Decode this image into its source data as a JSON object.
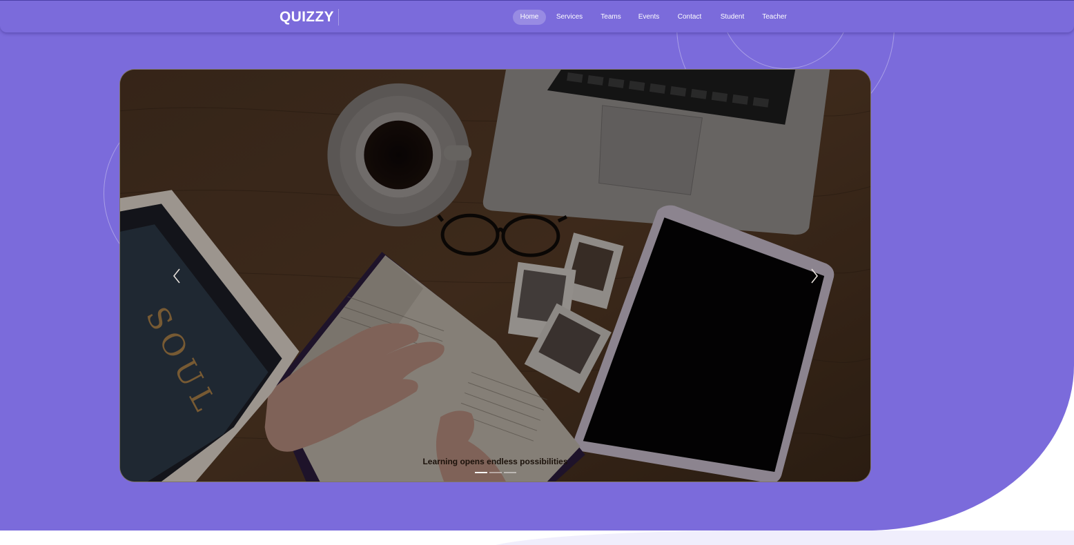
{
  "brand": {
    "name": "QUIZZY"
  },
  "nav": {
    "items": [
      {
        "label": "Home",
        "active": true
      },
      {
        "label": "Services",
        "active": false
      },
      {
        "label": "Teams",
        "active": false
      },
      {
        "label": "Events",
        "active": false
      },
      {
        "label": "Contact",
        "active": false
      },
      {
        "label": "Student",
        "active": false
      },
      {
        "label": "Teacher",
        "active": false
      }
    ]
  },
  "carousel": {
    "caption": "Learning opens endless possibilities",
    "slide_count": 3,
    "active_slide": 1,
    "prev_icon": "chevron-left-icon",
    "next_icon": "chevron-right-icon"
  },
  "colors": {
    "brand_purple": "#7b6bdb",
    "light_band": "#f0eefc",
    "white": "#ffffff"
  }
}
